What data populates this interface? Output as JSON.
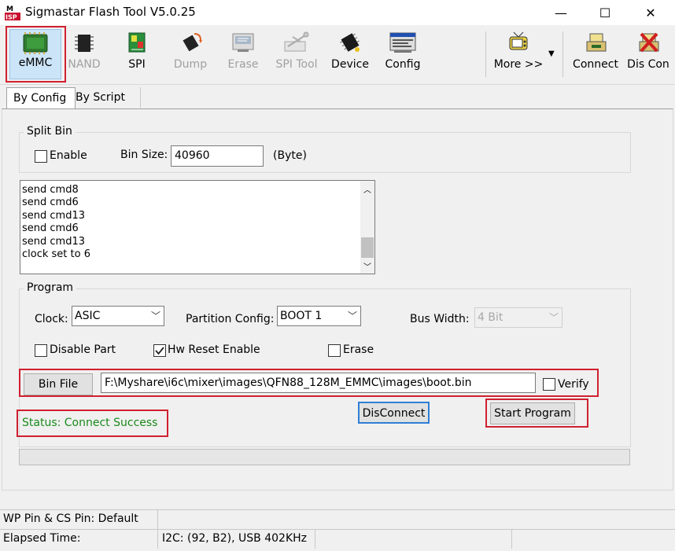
{
  "window": {
    "title": "Sigmastar Flash Tool V5.0.25",
    "logo_text_top": "M",
    "logo_text_bottom": "ISP",
    "minimize": "—",
    "maximize": "☐",
    "close": "✕"
  },
  "toolbar": {
    "items": [
      {
        "label": "eMMC",
        "icon": "emmc-chip-icon",
        "selected": true,
        "enabled": true
      },
      {
        "label": "NAND",
        "icon": "nand-chip-icon",
        "selected": false,
        "enabled": false
      },
      {
        "label": "SPI",
        "icon": "spi-icon",
        "selected": false,
        "enabled": true
      },
      {
        "label": "Dump",
        "icon": "dump-icon",
        "selected": false,
        "enabled": false
      },
      {
        "label": "Erase",
        "icon": "erase-icon",
        "selected": false,
        "enabled": false
      },
      {
        "label": "SPI Tool",
        "icon": "spi-tool-icon",
        "selected": false,
        "enabled": false
      },
      {
        "label": "Device",
        "icon": "device-icon",
        "selected": false,
        "enabled": true
      },
      {
        "label": "Config",
        "icon": "config-icon",
        "selected": false,
        "enabled": true
      }
    ],
    "more_label": "More >>",
    "connect_label": "Connect",
    "discon_label": "Dis Con"
  },
  "tabs": [
    {
      "label": "By Config",
      "active": true
    },
    {
      "label": "By Script",
      "active": false
    }
  ],
  "split_bin": {
    "title": "Split Bin",
    "enable_label": "Enable",
    "enable_checked": false,
    "bin_size_label": "Bin Size:",
    "bin_size_value": "40960",
    "unit_label": "(Byte)"
  },
  "log": {
    "lines": [
      "send cmd8",
      "send cmd6",
      "send cmd13",
      "send cmd6",
      "send cmd13",
      "clock set to 6"
    ]
  },
  "program": {
    "title": "Program",
    "clock_label": "Clock:",
    "clock_value": "ASIC",
    "partition_label": "Partition Config:",
    "partition_value": "BOOT 1",
    "bus_width_label": "Bus Width:",
    "bus_width_value": "4 Bit",
    "disable_part_label": "Disable Part",
    "disable_part_checked": false,
    "hw_reset_label": "Hw Reset Enable",
    "hw_reset_checked": true,
    "erase_label": "Erase",
    "erase_checked": false,
    "bin_file_button": "Bin File",
    "bin_file_path": "F:\\Myshare\\i6c\\mixer\\images\\QFN88_128M_EMMC\\images\\boot.bin",
    "verify_label": "Verify",
    "verify_checked": false,
    "disconnect_button": "DisConnect",
    "start_button": "Start Program",
    "status_text": "Status: Connect Success",
    "progress": 0
  },
  "statusbar": {
    "wp_pin": "WP Pin & CS Pin: Default",
    "elapsed_label": "Elapsed Time:",
    "i2c_info": "I2C: (92, B2), USB  402KHz"
  },
  "colors": {
    "highlight_red": "#d02030",
    "status_green": "#1a8a1a",
    "focus_blue": "#2f7fd6"
  }
}
